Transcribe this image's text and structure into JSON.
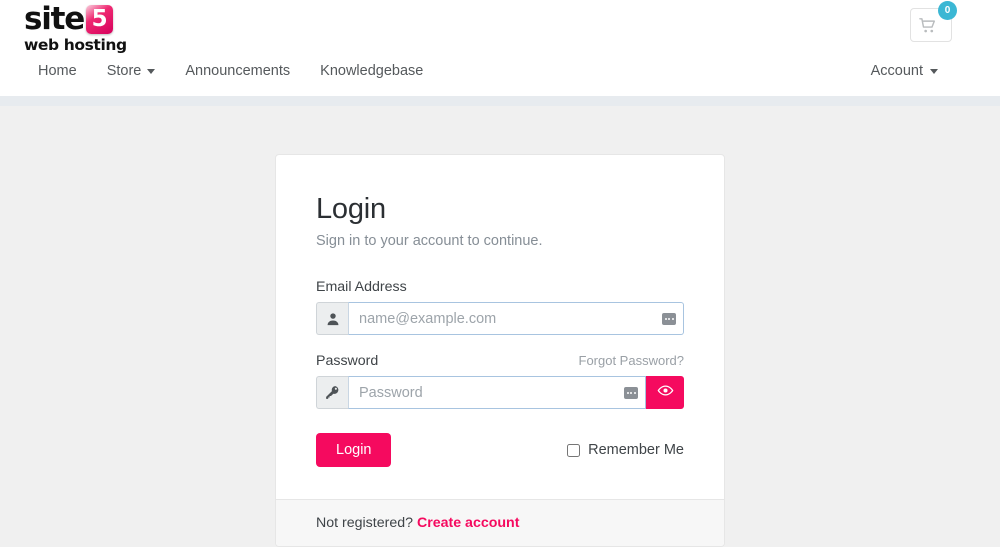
{
  "header": {
    "logo": {
      "name": "site",
      "badge": "5",
      "tagline": "web hosting"
    },
    "cart": {
      "icon": "shopping-cart-icon",
      "count": "0",
      "badge_color": "#3bb7d4"
    },
    "nav": [
      {
        "label": "Home",
        "has_dropdown": false
      },
      {
        "label": "Store",
        "has_dropdown": true
      },
      {
        "label": "Announcements",
        "has_dropdown": false
      },
      {
        "label": "Knowledgebase",
        "has_dropdown": false
      }
    ],
    "account": {
      "label": "Account",
      "has_dropdown": true
    }
  },
  "login": {
    "title": "Login",
    "subtitle": "Sign in to your account to continue.",
    "email": {
      "label": "Email Address",
      "placeholder": "name@example.com",
      "value": "",
      "prefix_icon": "user-icon"
    },
    "password": {
      "label": "Password",
      "forgot_label": "Forgot Password?",
      "placeholder": "Password",
      "value": "",
      "prefix_icon": "key-icon",
      "toggle_icon": "eye-icon"
    },
    "submit_label": "Login",
    "remember_label": "Remember Me",
    "remember_checked": false,
    "footer": {
      "prompt": "Not registered?",
      "link_label": "Create account"
    },
    "accent_color": "#f50a5f"
  }
}
